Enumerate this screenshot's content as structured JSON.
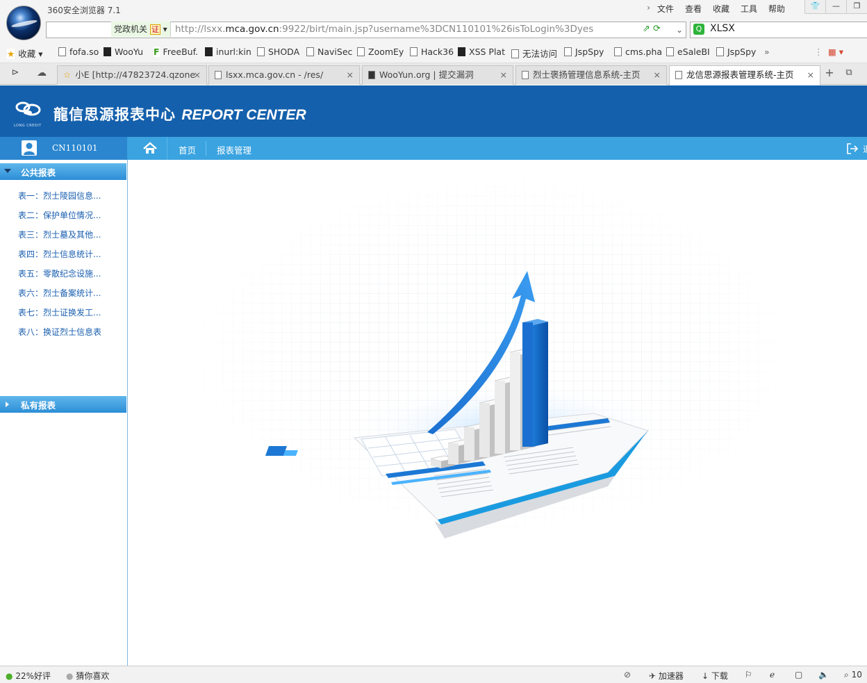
{
  "browser": {
    "title": "360安全浏览器 7.1",
    "menu": [
      "文件",
      "查看",
      "收藏",
      "工具",
      "帮助"
    ],
    "gov_badge": "党政机关",
    "cert_label": "证",
    "url_prefix": "http://lsxx.",
    "url_domain": "mca.gov.cn",
    "url_rest": ":9922/birt/main.jsp?username%3DCN110101%26isToLogin%3Dyes",
    "search_text": "XLSX",
    "bookmarks": {
      "favorites": "收藏",
      "items": [
        "fofa.so",
        "WooYu",
        "FreeBuf.",
        "inurl:kin",
        "SHODA",
        "NaviSec",
        "ZoomEy",
        "Hack36",
        "XSS Plat",
        "无法访问",
        "JspSpy",
        "cms.pha",
        "eSaleBI",
        "JspSpy"
      ]
    },
    "tabs": [
      {
        "title": "小E [http://47823724.qzone"
      },
      {
        "title": "lsxx.mca.gov.cn - /res/"
      },
      {
        "title": "WooYun.org | 提交漏洞"
      },
      {
        "title": "烈士褒扬管理信息系统-主页"
      },
      {
        "title": "龙信思源报表管理系统-主页"
      }
    ],
    "status": {
      "rating": "22%好评",
      "guess": "猜你喜欢",
      "accelerator": "加速器",
      "download": "下载",
      "zoom": "10"
    }
  },
  "page": {
    "brand_name": "龍信思源报表中心",
    "brand_en": "REPORT CENTER",
    "brand_sub": "LONG CREDIT",
    "user": "CN110101",
    "nav": [
      "首页",
      "报表管理"
    ],
    "logout": "退",
    "public_reports_title": "公共报表",
    "public_reports": [
      "表一：烈士陵园信息...",
      "表二：保护单位情况...",
      "表三：烈士墓及其他...",
      "表四：烈士信息统计...",
      "表五：零散纪念设施...",
      "表六：烈士备案统计...",
      "表七：烈士证换发工...",
      "表八：换证烈士信息表"
    ],
    "private_reports_title": "私有报表",
    "colors": {
      "header": "#1460ac",
      "nav": "#3aa3e0",
      "accent": "#2b86cf"
    }
  }
}
